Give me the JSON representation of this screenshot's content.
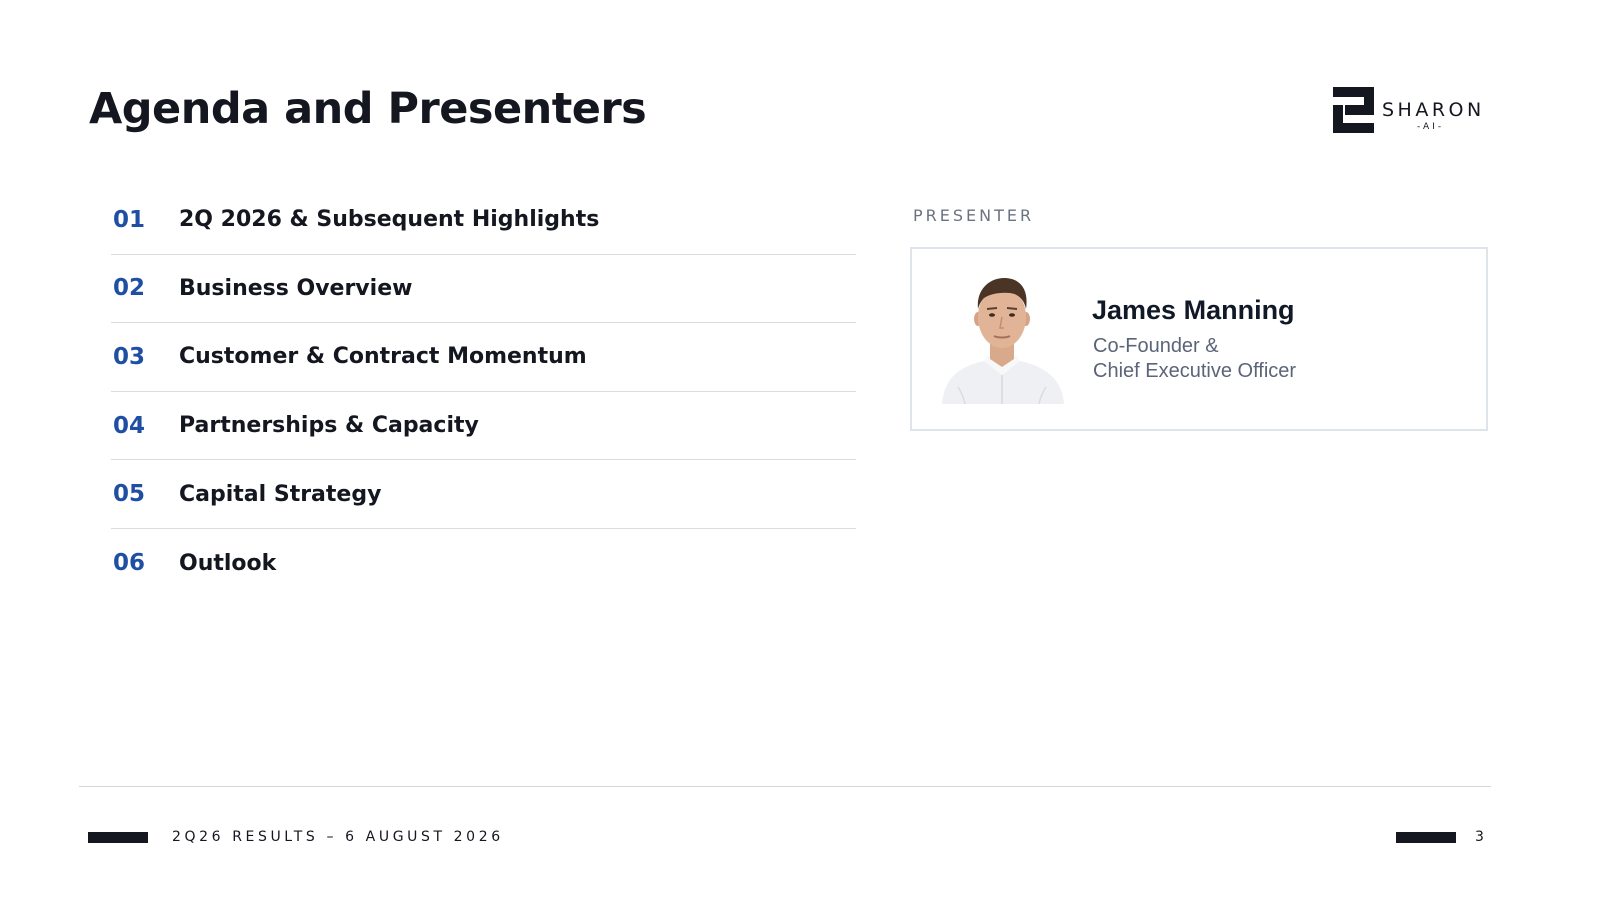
{
  "header": {
    "title": "Agenda and Presenters",
    "logo": {
      "word": "SHARON",
      "sub": "-AI-"
    }
  },
  "agenda": {
    "items": [
      {
        "number": "01",
        "label": "2Q 2026 & Subsequent Highlights"
      },
      {
        "number": "02",
        "label": "Business Overview"
      },
      {
        "number": "03",
        "label": "Customer & Contract Momentum"
      },
      {
        "number": "04",
        "label": "Partnerships & Capacity"
      },
      {
        "number": "05",
        "label": "Capital Strategy"
      },
      {
        "number": "06",
        "label": "Outlook"
      }
    ]
  },
  "presenter": {
    "section_label": "PRESENTER",
    "name": "James Manning",
    "role_line1": "Co-Founder &",
    "role_line2": "Chief Executive Officer"
  },
  "footer": {
    "text": "2Q26 RESULTS – 6 AUGUST 2026",
    "page_number": "3"
  },
  "colors": {
    "accent": "#1f4fa3",
    "text": "#14171f",
    "muted": "#5b6478",
    "rule": "#d9dce2"
  }
}
